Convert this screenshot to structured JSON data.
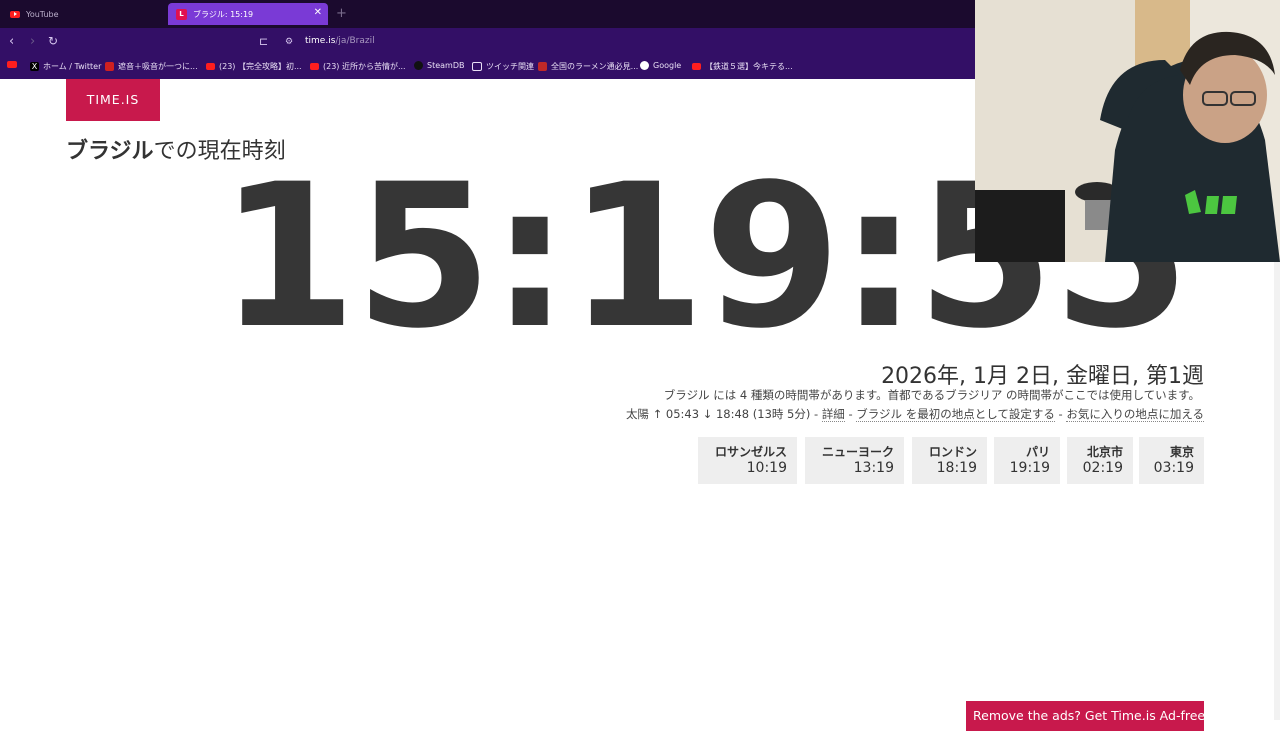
{
  "browser": {
    "tabs": [
      {
        "label": "YouTube",
        "active": false
      },
      {
        "label": "ブラジル: 15:19",
        "active": true
      }
    ],
    "url_host": "time.is",
    "url_path": "/ja/Brazil",
    "bookmarks": [
      "ホーム / Twitter",
      "遮音＋吸音が一つに...",
      "(23) 【完全攻略】初...",
      "(23) 近所から苦情が...",
      "SteamDB",
      "ツイッチ関連",
      "全国のラーメン通必見...",
      "Google",
      "【鉄道５選】今キテる..."
    ]
  },
  "page": {
    "logo": "TIME.IS",
    "heading_bold": "ブラジル",
    "heading_rest": "での現在時刻",
    "clock": "15:19:55",
    "date": "2026年, 1月 2日, 金曜日, 第1週",
    "tz_info": "ブラジル には 4 種類の時間帯があります。首都であるブラジリア の時間帯がここでは使用しています。",
    "sun_text": "太陽 ↑ 05:43 ↓ 18:48 (13時 5分) - ",
    "details_link": "詳細",
    "sep": " - ",
    "set_first_link": "ブラジル を最初の地点として設定する",
    "favorite_link": "お気に入りの地点に加える",
    "cities": [
      {
        "name": "ロサンゼルス",
        "time": "10:19"
      },
      {
        "name": "ニューヨーク",
        "time": "13:19"
      },
      {
        "name": "ロンドン",
        "time": "18:19"
      },
      {
        "name": "パリ",
        "time": "19:19"
      },
      {
        "name": "北京市",
        "time": "02:19"
      },
      {
        "name": "東京",
        "time": "03:19"
      }
    ],
    "ad_banner": "Remove the ads? Get Time.is Ad-free!"
  },
  "colors": {
    "brand": "#c8194c",
    "browser_bg": "#330f66",
    "active_tab": "#7a3ad6"
  }
}
